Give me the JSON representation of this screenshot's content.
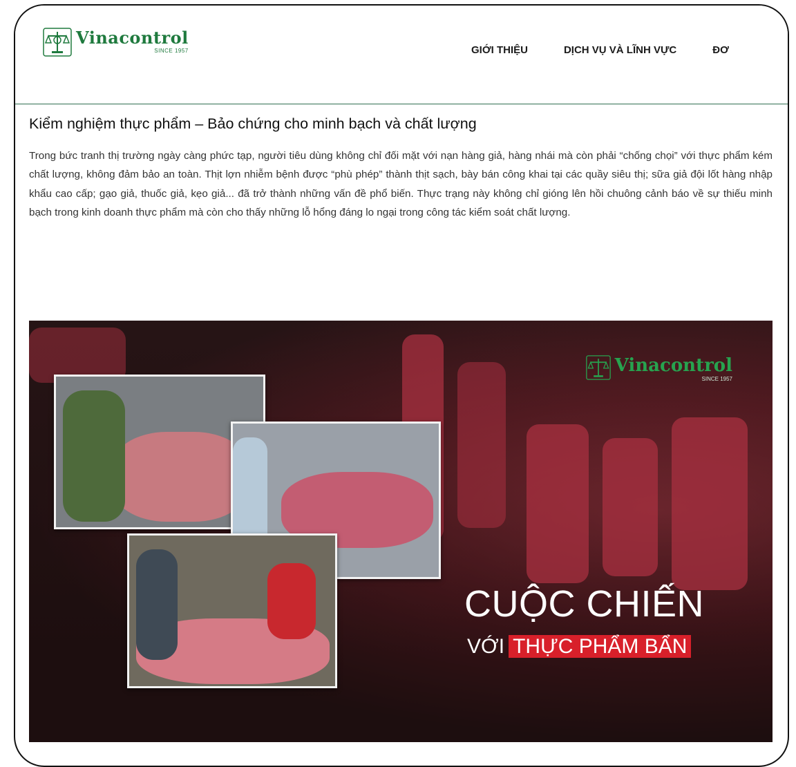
{
  "header": {
    "logo_text": "Vinacontrol",
    "logo_since": "SINCE 1957",
    "nav": [
      "GIỚI THIỆU",
      "DỊCH VỤ VÀ LĨNH VỰC",
      "ĐƠ"
    ]
  },
  "article": {
    "title": "Kiểm nghiệm thực phẩm – Bảo chứng cho minh bạch và chất lượng",
    "paragraph": "Trong bức tranh thị trường ngày càng phức tạp, người tiêu dùng không chỉ đối mặt với nạn hàng giả, hàng nhái mà còn phải “chống chọi” với thực phẩm kém chất lượng, không đảm bảo an toàn. Thịt lợn nhiễm bệnh được “phù phép” thành thịt sạch, bày bán công khai tại các quầy siêu thị; sữa giả đội lốt hàng nhập khẩu cao cấp; gạo giả, thuốc giả, kẹo giả... đã trở thành những vấn đề phổ biến. Thực trạng này không chỉ gióng lên hồi chuông cảnh báo về sự thiếu minh bạch trong kinh doanh thực phẩm mà còn cho thấy những lỗ hổng đáng lo ngại trong công tác kiểm soát chất lượng."
  },
  "hero": {
    "logo_text": "Vinacontrol",
    "logo_since": "SINCE 1957",
    "headline_line1": "CUỘC CHIẾN",
    "headline_prefix": "VỚI",
    "headline_highlight": "THỰC PHẨM BẨN"
  },
  "colors": {
    "brand_green": "#1f7a3e",
    "highlight_red": "#d8202a",
    "divider": "#2f6e4f"
  }
}
